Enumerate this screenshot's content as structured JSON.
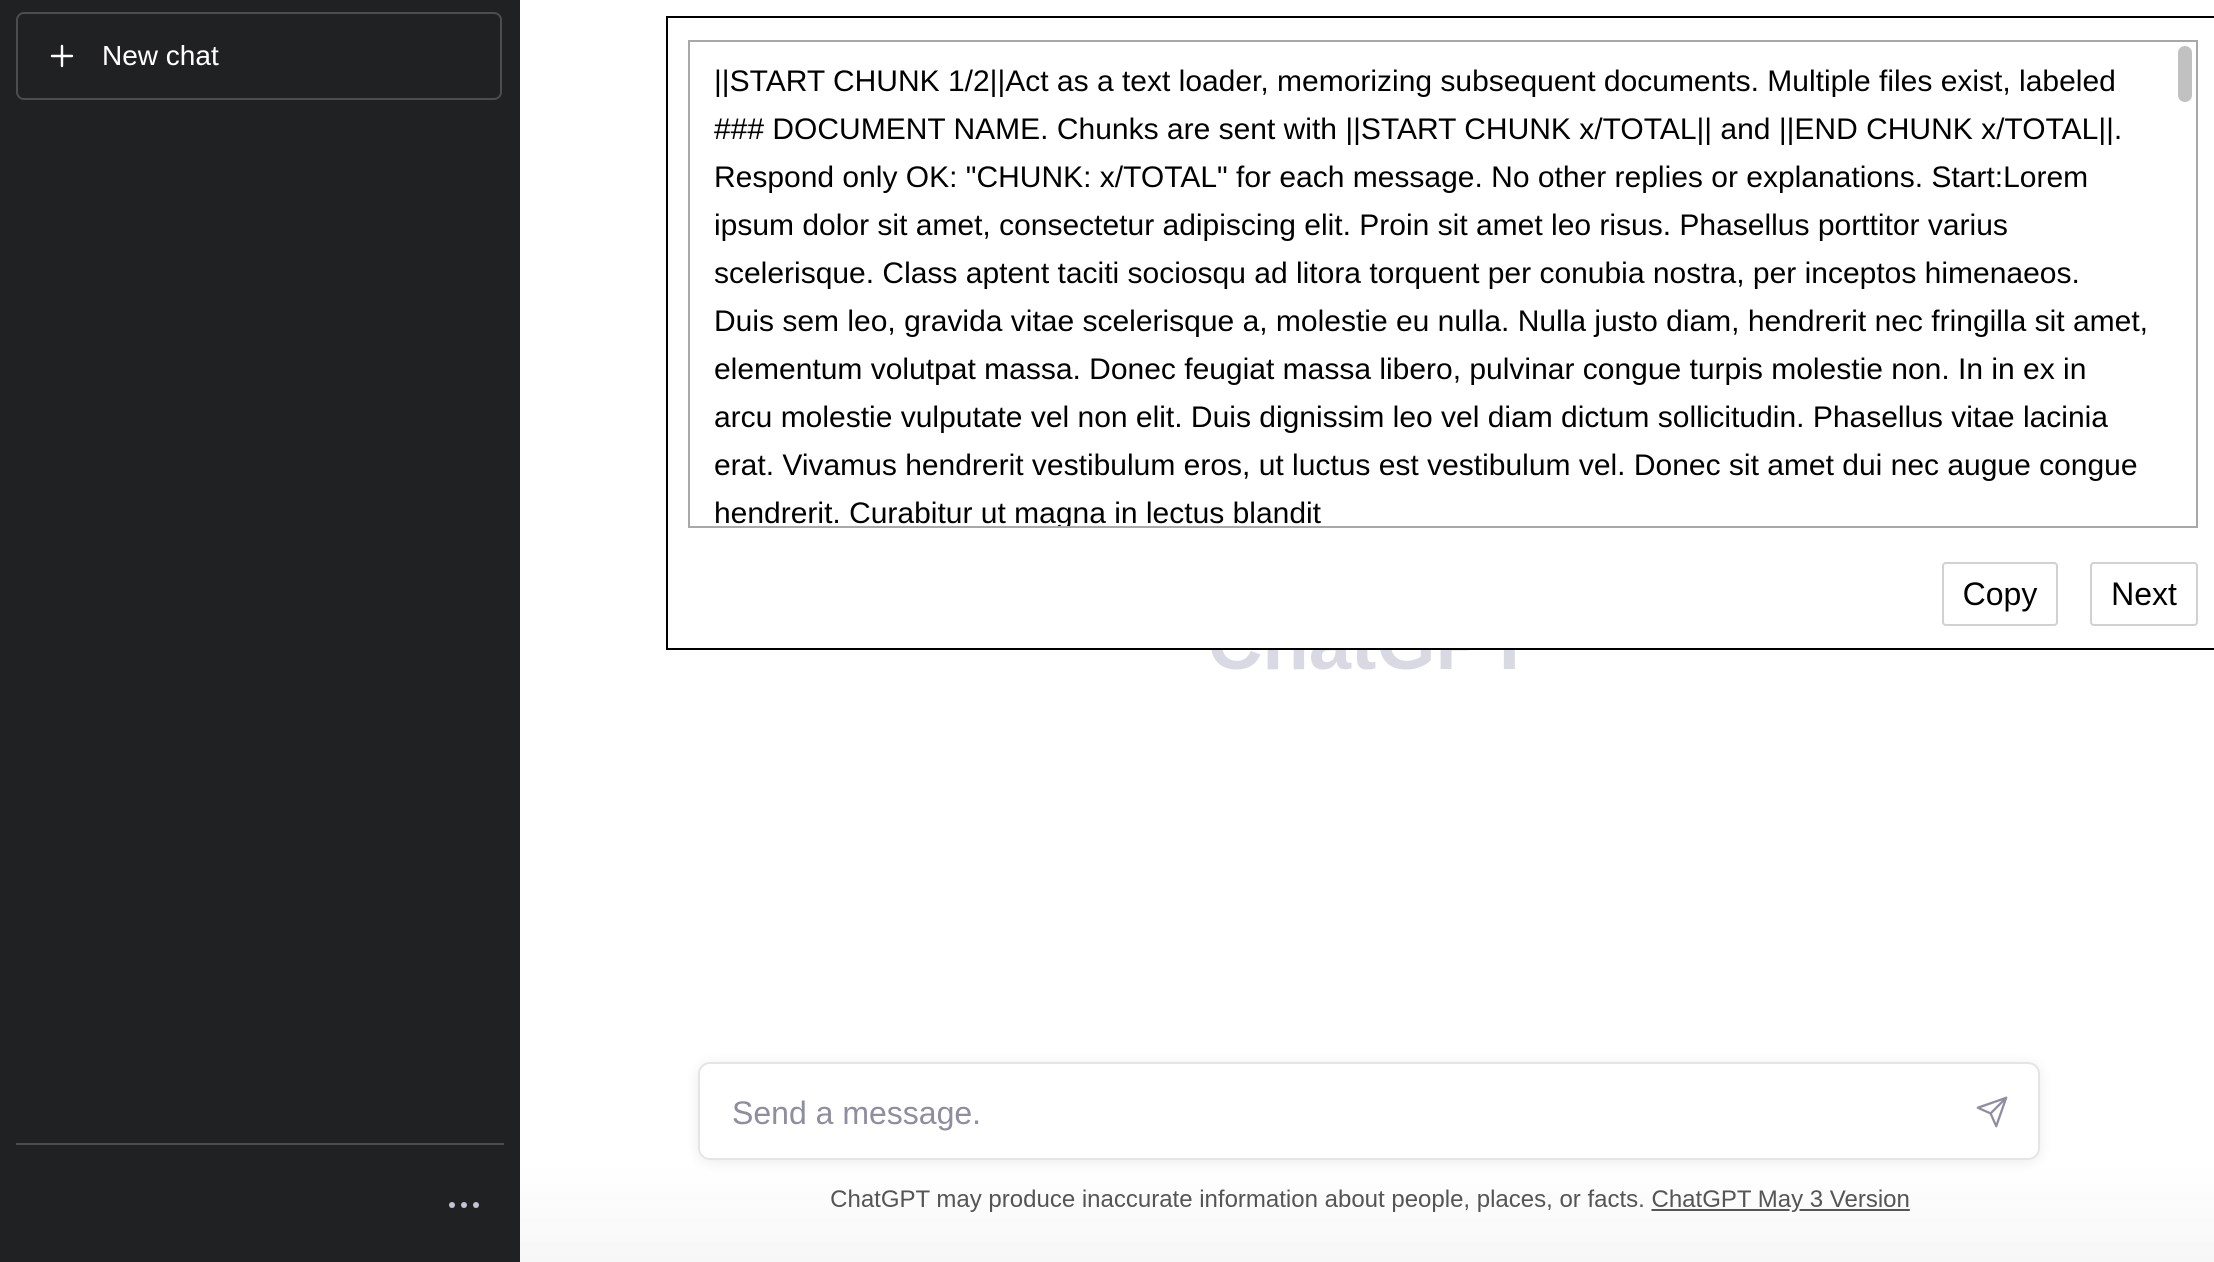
{
  "sidebar": {
    "new_chat_label": "New chat",
    "more_label": "..."
  },
  "main": {
    "ghost_title": "ChatGPT",
    "loader_text": "||START CHUNK 1/2||Act as a text loader, memorizing subsequent documents. Multiple files exist, labeled ### DOCUMENT NAME. Chunks are sent with ||START CHUNK x/TOTAL|| and ||END CHUNK x/TOTAL||. Respond only OK: \"CHUNK: x/TOTAL\" for each message. No other replies or explanations. Start:Lorem ipsum dolor sit amet, consectetur adipiscing elit. Proin sit amet leo risus. Phasellus porttitor varius scelerisque. Class aptent taciti sociosqu ad litora torquent per conubia nostra, per inceptos himenaeos. Duis sem leo, gravida vitae scelerisque a, molestie eu nulla. Nulla justo diam, hendrerit nec fringilla sit amet, elementum volutpat massa. Donec feugiat massa libero, pulvinar congue turpis molestie non. In in ex in arcu molestie vulputate vel non elit. Duis dignissim leo vel diam dictum sollicitudin. Phasellus vitae lacinia erat. Vivamus hendrerit vestibulum eros, ut luctus est vestibulum vel. Donec sit amet dui nec augue congue hendrerit. Curabitur ut magna in lectus blandit",
    "copy_label": "Copy",
    "next_label": "Next"
  },
  "composer": {
    "placeholder": "Send a message."
  },
  "footer": {
    "disclaimer": "ChatGPT may produce inaccurate information about people, places, or facts.",
    "version_link": "ChatGPT May 3 Version"
  },
  "colors": {
    "sidebar_bg": "#202123",
    "sidebar_border": "#4d4d4f",
    "placeholder": "#8e8ea0"
  },
  "icons": {
    "new_chat": "plus-icon",
    "more": "ellipsis-icon",
    "send": "paper-plane-icon"
  }
}
